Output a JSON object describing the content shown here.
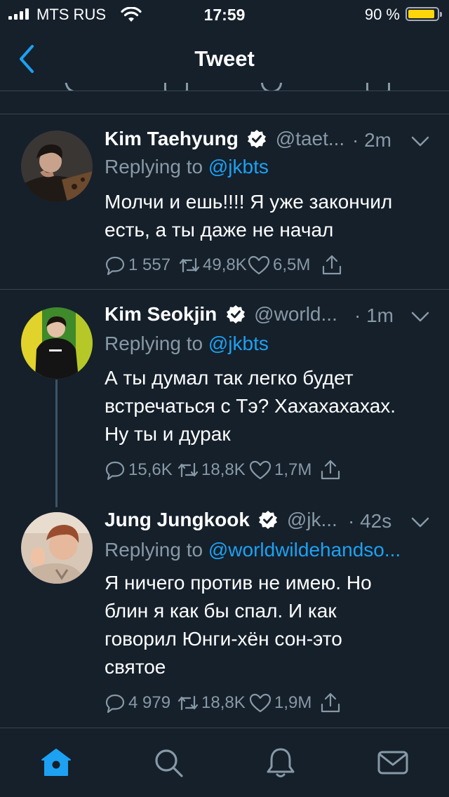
{
  "status_bar": {
    "carrier": "MTS RUS",
    "time": "17:59",
    "battery": "90 %",
    "battery_level_fraction": 0.9
  },
  "nav": {
    "title": "Tweet",
    "back_icon": "chevron-left-icon"
  },
  "tweets": [
    {
      "name": "Kim Taehyung",
      "verified": true,
      "handle": "@taet...",
      "time": "· 2m",
      "replying_prefix": "Replying to ",
      "replying_to": "@jkbts",
      "text_lines": [
        "Молчи и ешь!!!! Я уже закончил",
        "есть, а ты даже не начал"
      ],
      "replies": "1 557",
      "retweets": "49,8K",
      "likes": "6,5M"
    },
    {
      "name": "Kim Seokjin",
      "verified": true,
      "handle": "@world...",
      "time": "· 1m",
      "replying_prefix": "Replying to ",
      "replying_to": "@jkbts",
      "text_lines": [
        "А ты думал так легко будет",
        "встречаться с Тэ? Хахахахахах.",
        "Ну ты и дурак"
      ],
      "replies": "15,6K",
      "retweets": "18,8K",
      "likes": "1,7M"
    },
    {
      "name": "Jung Jungkook",
      "verified": true,
      "handle": "@jk...",
      "time": "· 42s",
      "replying_prefix": "Replying to ",
      "replying_to": "@worldwildehandso...",
      "text_lines": [
        "Я ничего против не имею. Но",
        "блин я как бы спал. И как",
        "говорил Юнги-хён сон-это",
        "святое"
      ],
      "replies": "4 979",
      "retweets": "18,8K",
      "likes": "1,9M"
    }
  ],
  "tab_bar": {
    "items": [
      "home-icon",
      "search-icon",
      "notifications-icon",
      "messages-icon"
    ],
    "active": "home-icon"
  },
  "colors": {
    "background": "#15202b",
    "accent": "#1da1f2",
    "secondary_text": "#8899a6",
    "divider": "#38444d",
    "battery": "#ffd60a"
  }
}
